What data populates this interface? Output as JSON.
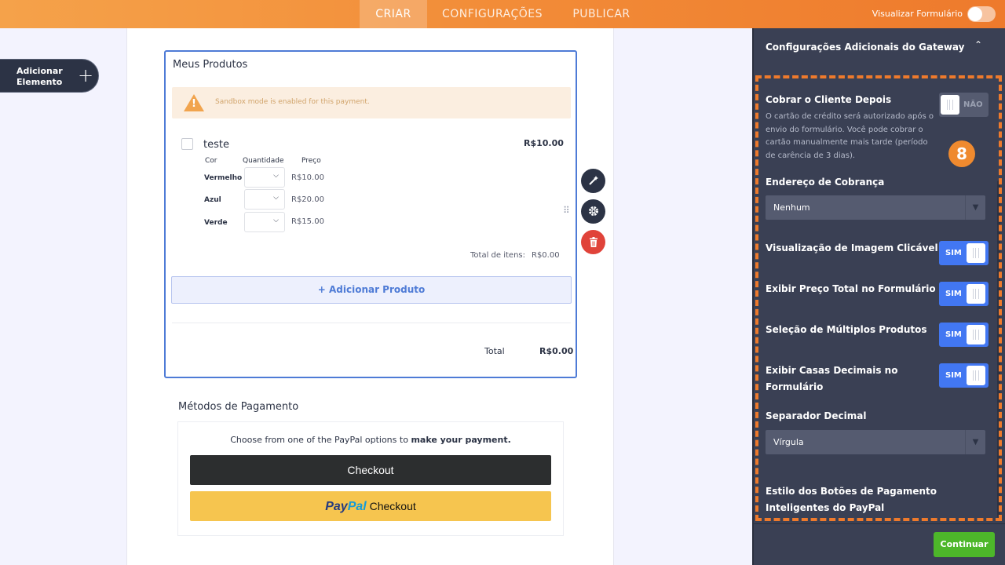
{
  "topbar": {
    "tabs": [
      {
        "label": "CRIAR",
        "active": true
      },
      {
        "label": "CONFIGURAÇÕES",
        "active": false
      },
      {
        "label": "PUBLICAR",
        "active": false
      }
    ],
    "preview_label": "Visualizar Formulário",
    "preview_on": false
  },
  "left": {
    "add_element_label": "Adicionar Elemento",
    "add_icon": "plus-icon"
  },
  "products": {
    "title": "Meus Produtos",
    "sandbox_msg": "Sandbox mode is enabled for this payment.",
    "product": {
      "name": "teste",
      "price": "R$10.00",
      "headers": {
        "color": "Cor",
        "qty": "Quantidade",
        "price": "Preço"
      },
      "options": [
        {
          "color": "Vermelho",
          "price": "R$10.00"
        },
        {
          "color": "Azul",
          "price": "R$20.00"
        },
        {
          "color": "Verde",
          "price": "R$15.00"
        }
      ]
    },
    "total_items_label": "Total de itens:",
    "total_items_value": "R$0.00",
    "add_product_label": "+ Adicionar Produto",
    "total_label": "Total",
    "total_value": "R$0.00"
  },
  "payment": {
    "title": "Métodos de Pagamento",
    "text_plain": "Choose from one of the PayPal options to ",
    "text_bold": "make your payment.",
    "checkout_label": "Checkout",
    "paypal_word_1": "Pay",
    "paypal_word_2": "Pal",
    "paypal_checkout_label": "Checkout"
  },
  "panel": {
    "header_title": "Configurações Adicionais do Gateway",
    "badge": "8",
    "charge_later": {
      "label": "Cobrar o Cliente Depois",
      "desc": "O cartão de crédito será autorizado após o envio do formulário. Você pode cobrar o cartão manualmente mais tarde (período de carência de 3 dias).",
      "toggle_text": "NÃO"
    },
    "billing": {
      "label": "Endereço de Cobrança",
      "value": "Nenhum"
    },
    "toggles": [
      {
        "label": "Visualização de Imagem Clicável",
        "text": "SIM"
      },
      {
        "label": "Exibir Preço Total no Formulário",
        "text": "SIM"
      },
      {
        "label": "Seleção de Múltiplos Produtos",
        "text": "SIM"
      },
      {
        "label": "Exibir Casas Decimais no Formulário",
        "text": "SIM"
      }
    ],
    "decimal": {
      "label": "Separador Decimal",
      "value": "Vírgula"
    },
    "smart_buttons_label": "Estilo dos Botões de Pagamento Inteligentes do PayPal",
    "continue_label": "Continuar"
  },
  "colors": {
    "accent_orange": "#ee7a2c",
    "primary_blue": "#4e7bd6",
    "toggle_blue": "#4277f2",
    "continue_green": "#4db72a",
    "delete_red": "#e0433a",
    "paypal_yellow": "#f6c54f"
  }
}
